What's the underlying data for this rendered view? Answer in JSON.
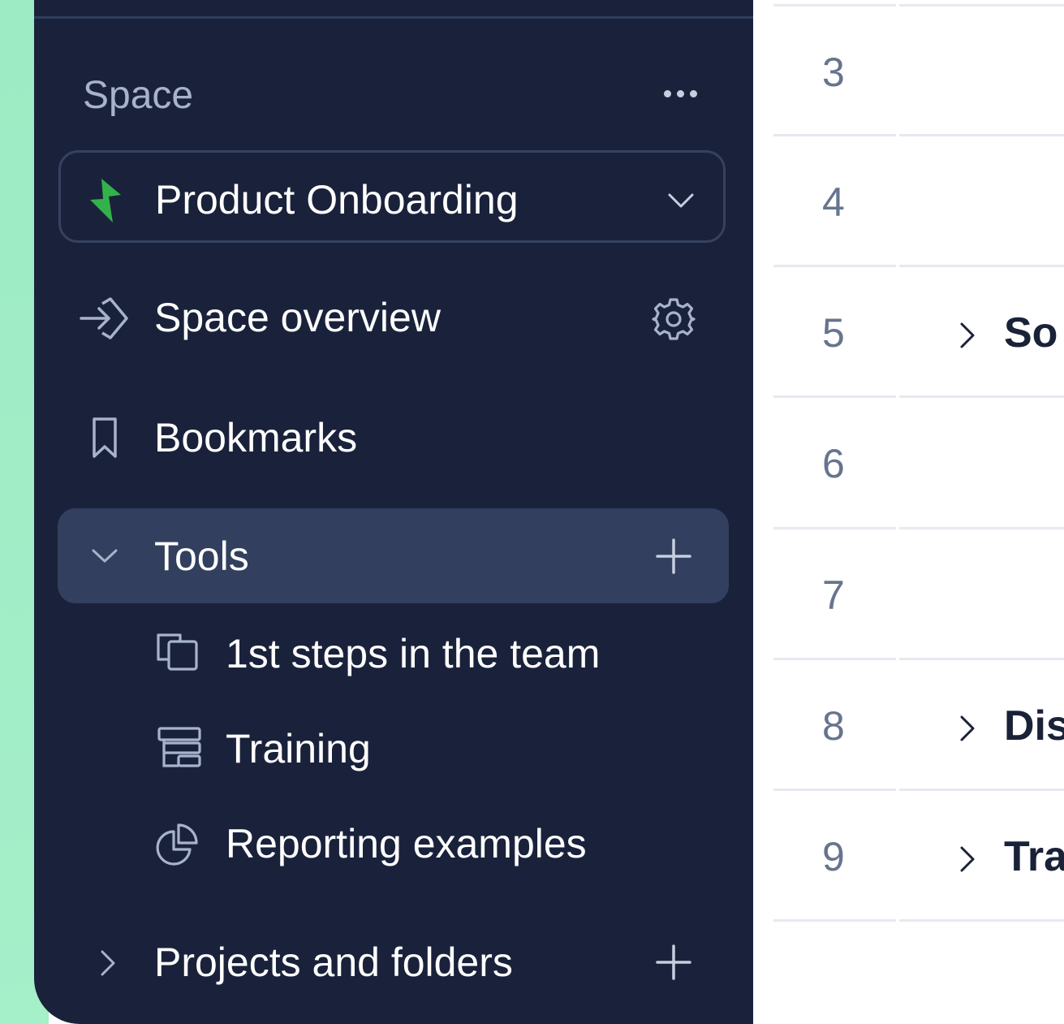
{
  "sidebar": {
    "section_label": "Space",
    "space_name": "Product Onboarding",
    "nav": [
      {
        "label": "Space overview",
        "icon": "arrow-right-icon"
      },
      {
        "label": "Bookmarks",
        "icon": "bookmark-icon"
      }
    ],
    "tools": {
      "label": "Tools",
      "items": [
        {
          "label": "1st steps in the team",
          "icon": "cards-icon"
        },
        {
          "label": "Training",
          "icon": "table-icon"
        },
        {
          "label": "Reporting examples",
          "icon": "pie-chart-icon"
        }
      ]
    },
    "projects": {
      "label": "Projects and folders"
    }
  },
  "table": {
    "rows": [
      {
        "num": "3",
        "title": ""
      },
      {
        "num": "4",
        "title": ""
      },
      {
        "num": "5",
        "title": "So"
      },
      {
        "num": "6",
        "title": ""
      },
      {
        "num": "7",
        "title": ""
      },
      {
        "num": "8",
        "title": "Dis"
      },
      {
        "num": "9",
        "title": "Tra"
      }
    ]
  },
  "colors": {
    "sidebar_bg": "#1a223b",
    "selected_bg": "#323f5e",
    "accent_green": "#33b249",
    "mint_bg": "#a2eec7"
  }
}
